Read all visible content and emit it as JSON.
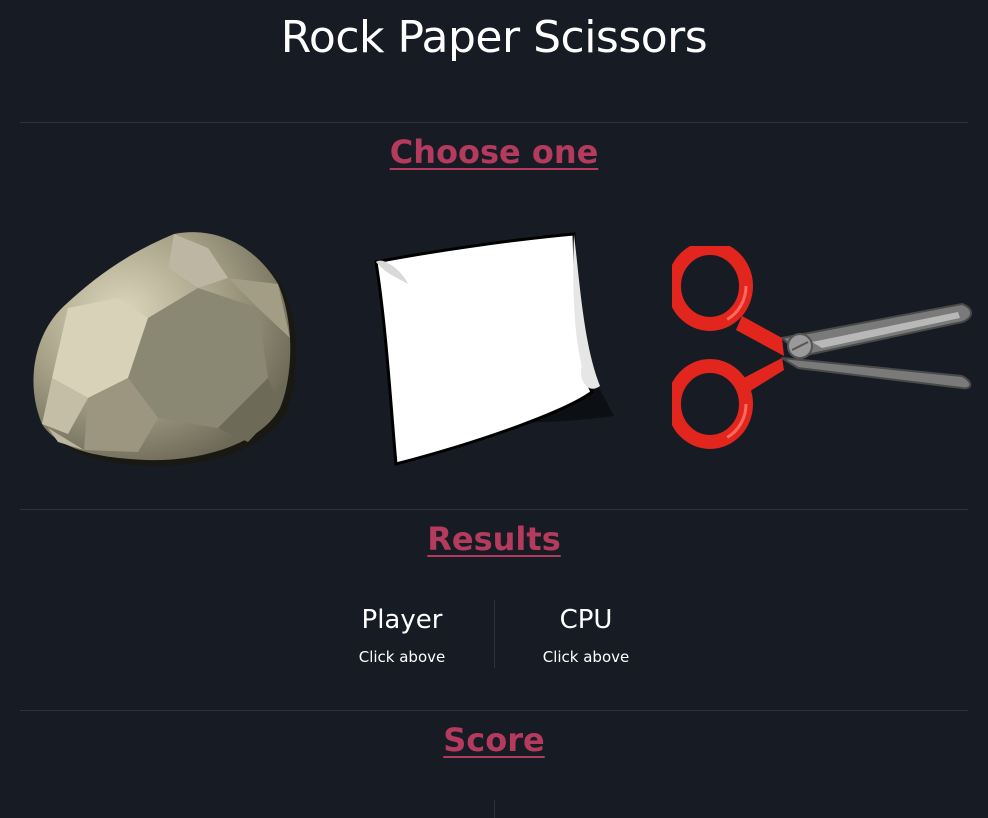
{
  "title": "Rock Paper Scissors",
  "choose": {
    "heading": "Choose one",
    "options": [
      {
        "label": "Rock",
        "icon": "rock-icon"
      },
      {
        "label": "Paper",
        "icon": "paper-icon"
      },
      {
        "label": "Scissors",
        "icon": "scissors-icon"
      }
    ]
  },
  "results": {
    "heading": "Results",
    "player": {
      "name": "Player",
      "choice": "Click above"
    },
    "cpu": {
      "name": "CPU",
      "choice": "Click above"
    }
  },
  "score": {
    "heading": "Score"
  },
  "colors": {
    "background": "#171c24",
    "accent": "#b43a5e",
    "divider": "#2c333e",
    "scissors_handle": "#e2261e"
  }
}
